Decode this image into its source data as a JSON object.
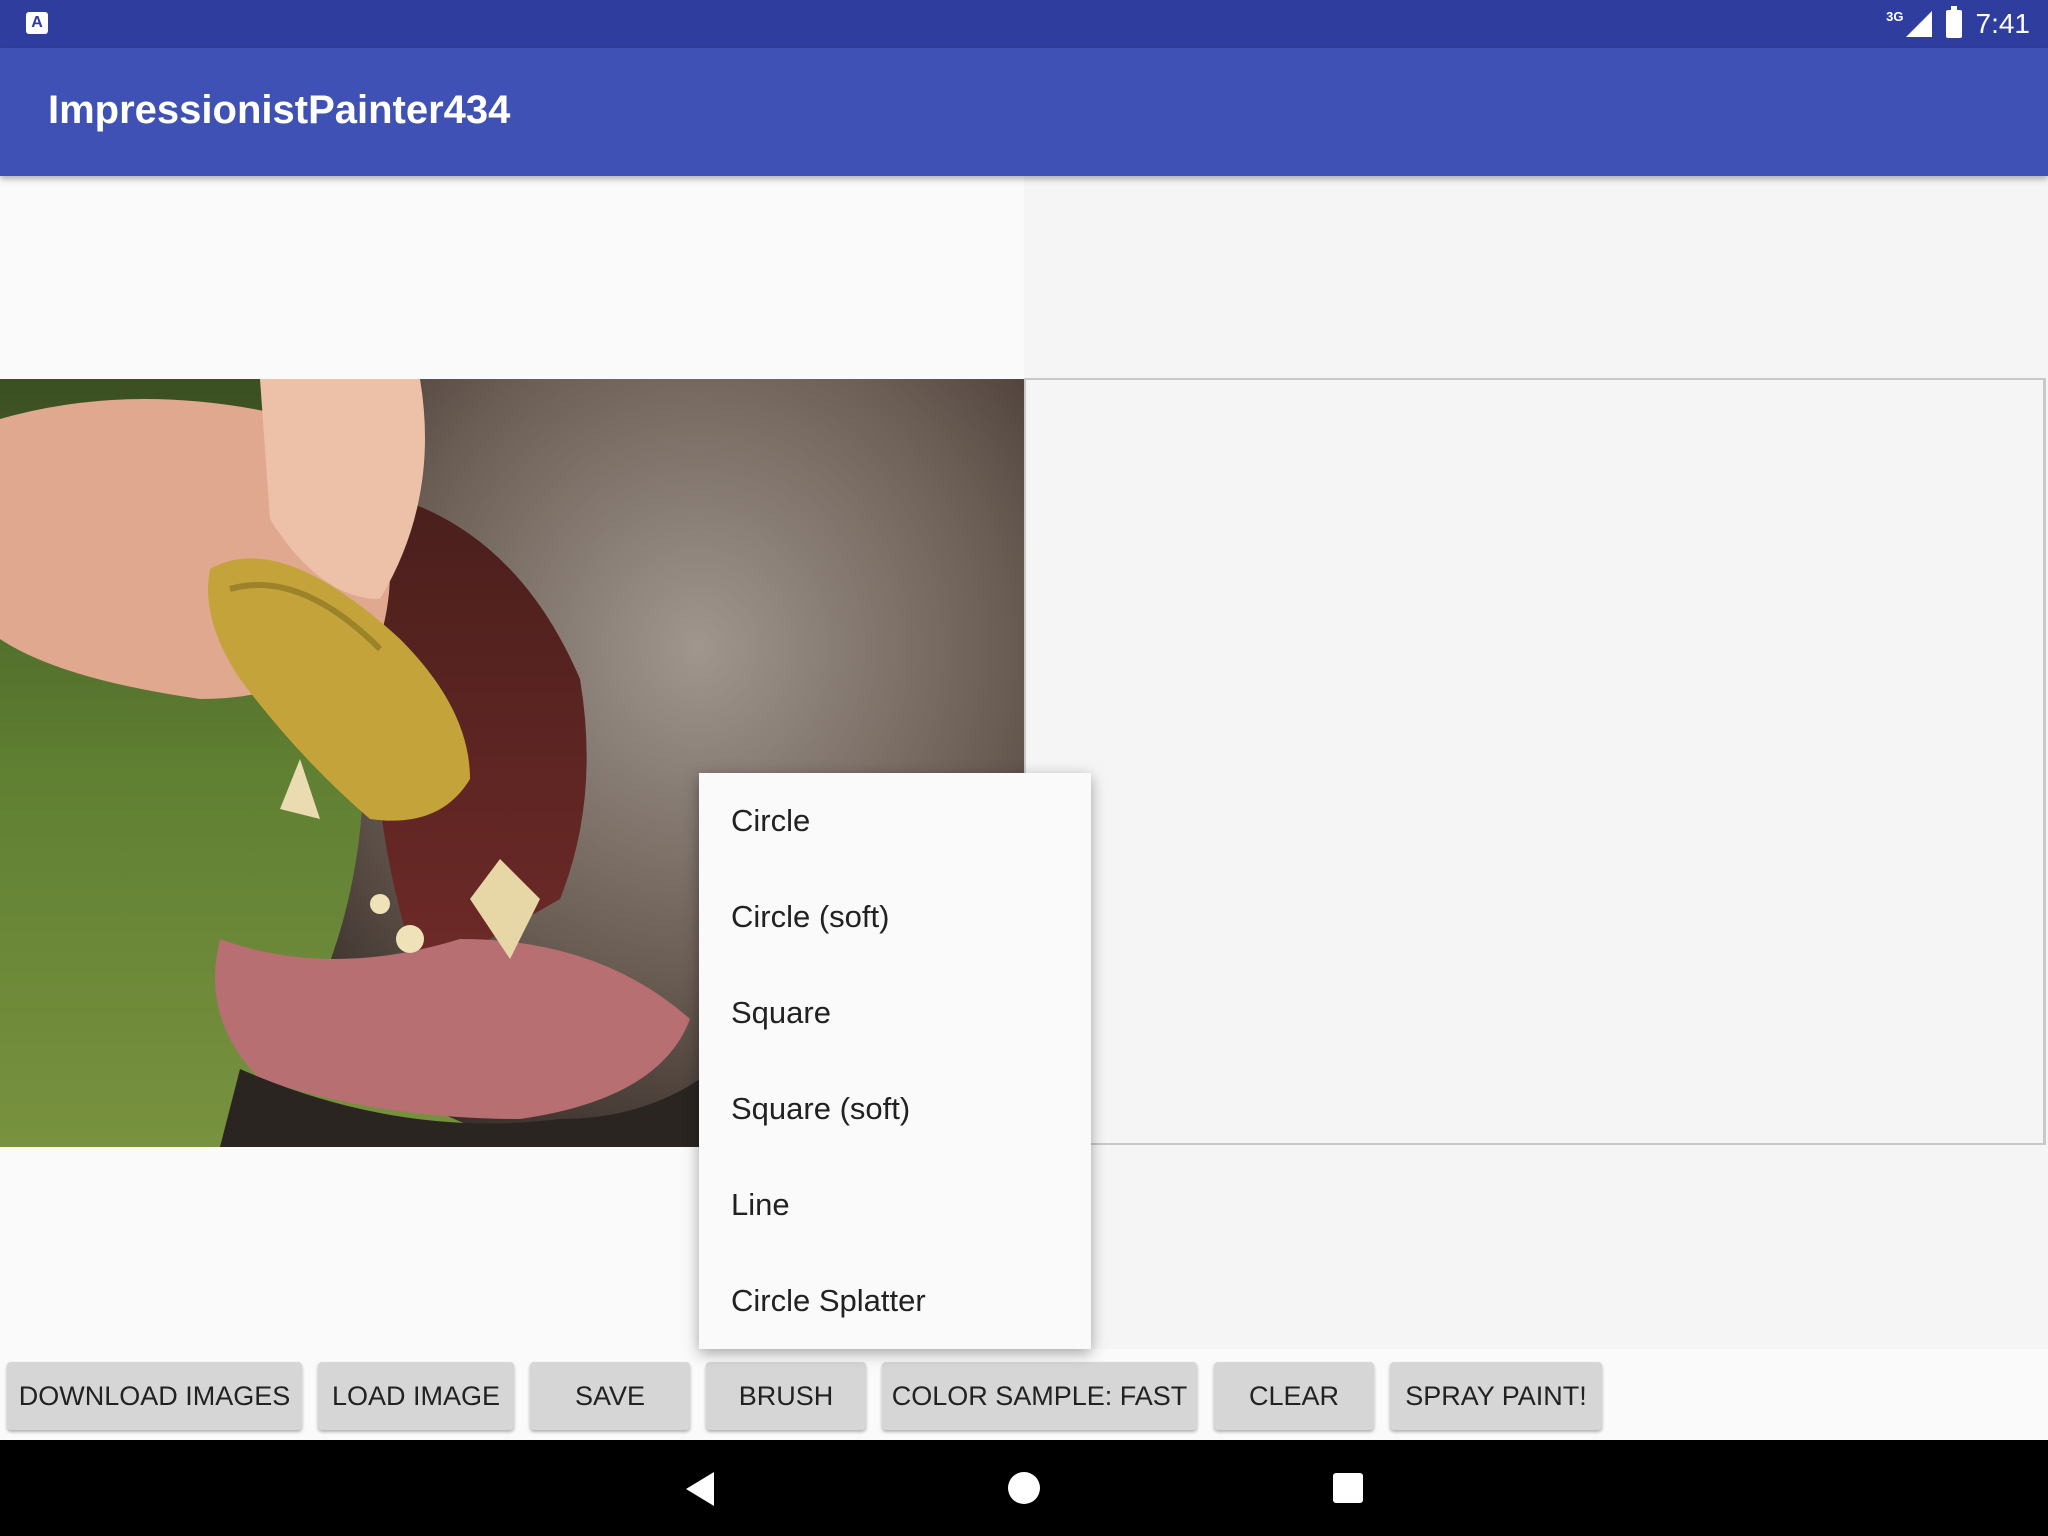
{
  "status_bar": {
    "network": "3G",
    "time": "7:41",
    "app_icon_letter": "A"
  },
  "app_bar": {
    "title": "ImpressionistPainter434"
  },
  "brush_menu": {
    "items": [
      "Circle",
      "Circle (soft)",
      "Square",
      "Square (soft)",
      "Line",
      "Circle Splatter"
    ]
  },
  "toolbar": {
    "download_images": "DOWNLOAD IMAGES",
    "load_image": "LOAD IMAGE",
    "save": "SAVE",
    "brush": "BRUSH",
    "color_sample": "COLOR SAMPLE: FAST",
    "clear": "CLEAR",
    "spray_paint": "SPRAY PAINT!"
  },
  "icons": {
    "back": "back-triangle-icon",
    "home": "home-circle-icon",
    "recents": "recents-square-icon"
  }
}
